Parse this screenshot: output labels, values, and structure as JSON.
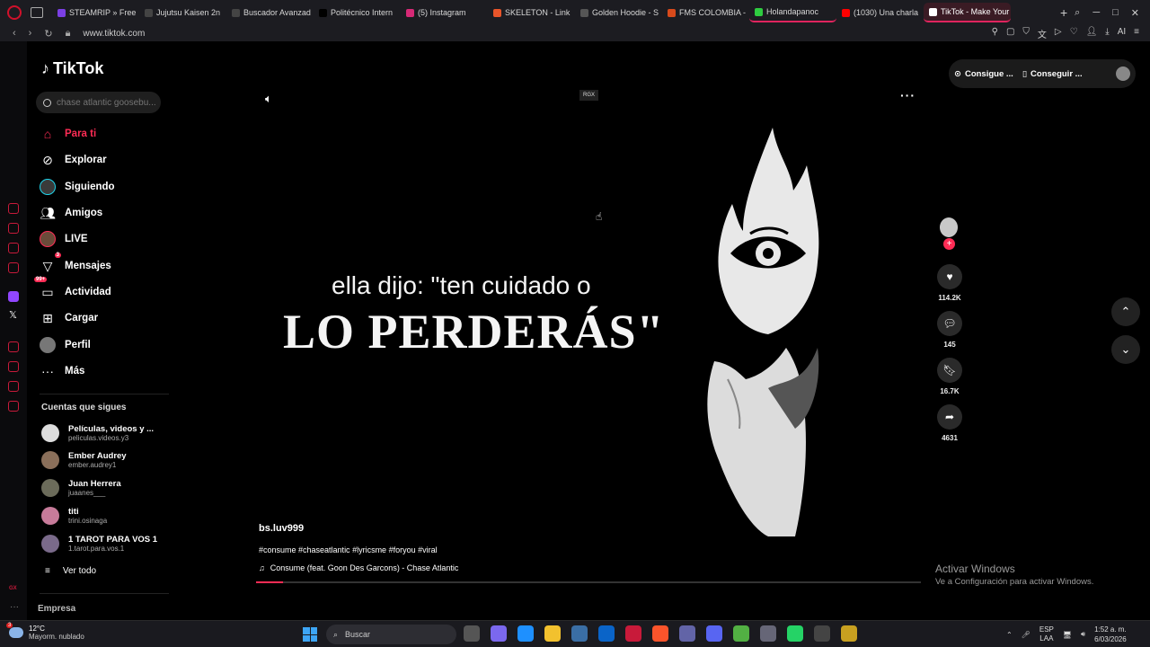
{
  "browser": {
    "tabs": [
      {
        "title": "STEAMRIP » Free",
        "color": "#7b3fe4"
      },
      {
        "title": "Jujutsu Kaisen 2n",
        "color": "#444444"
      },
      {
        "title": "Buscador Avanzad",
        "color": "#444444"
      },
      {
        "title": "Politécnico Intern",
        "color": "#000000"
      },
      {
        "title": "(5) Instagram",
        "color": "#d62976"
      },
      {
        "title": "SKELETON - Link",
        "color": "#e8552a"
      },
      {
        "title": "Golden Hoodie - S",
        "color": "#555555"
      },
      {
        "title": "FMS COLOMBIA -",
        "color": "#d84a1b"
      },
      {
        "title": "Holandapanoc",
        "color": "#2ecc40"
      },
      {
        "title": "(1030) Una charla",
        "color": "#ff0000"
      },
      {
        "title": "TikTok - Make Your Da",
        "color": "#ffffff"
      }
    ],
    "url": "www.tiktok.com"
  },
  "tiktok": {
    "logo": "TikTok",
    "search_placeholder": "chase atlantic goosebu...",
    "menu": [
      {
        "label": "Para ti",
        "icon": "home-icon"
      },
      {
        "label": "Explorar",
        "icon": "compass-icon"
      },
      {
        "label": "Siguiendo",
        "icon": "following-icon"
      },
      {
        "label": "Amigos",
        "icon": "friends-icon"
      },
      {
        "label": "LIVE",
        "icon": "live-icon"
      },
      {
        "label": "Mensajes",
        "icon": "messages-icon",
        "badge": "3"
      },
      {
        "label": "Actividad",
        "icon": "activity-icon",
        "badge": "99+"
      },
      {
        "label": "Cargar",
        "icon": "upload-icon"
      },
      {
        "label": "Perfil",
        "icon": "profile-icon"
      },
      {
        "label": "Más",
        "icon": "more-icon"
      }
    ],
    "following_title": "Cuentas que sigues",
    "following": [
      {
        "name": "Películas, videos y ...",
        "user": "peliculas.videos.y3"
      },
      {
        "name": "Ember Audrey",
        "user": "ember.audrey1"
      },
      {
        "name": "Juan Herrera",
        "user": "juaanes___"
      },
      {
        "name": "titi",
        "user": "trini.osinaga"
      },
      {
        "name": "1 TAROT PARA VOS 1",
        "user": "1.tarot.para.vos.1"
      }
    ],
    "see_all": "Ver todo",
    "footer": "Empresa",
    "pills": [
      "Consigue ...",
      "Conseguir ..."
    ]
  },
  "video": {
    "watermark": "RGX",
    "caption_line1": "ella dijo: \"ten cuidado o",
    "caption_line2": "LO PERDERÁS\"",
    "author": "bs.luv999",
    "hashtags": "#consume #chaseatlantic #lyricsme #foryou #viral",
    "song": "Consume (feat. Goon Des Garcons) - Chase Atlantic",
    "progress": 0.04,
    "likes": "114.2K",
    "comments": "145",
    "saves": "16.7K",
    "shares": "4631"
  },
  "windows": {
    "activate_title": "Activar Windows",
    "activate_sub": "Ve a Configuración para activar Windows.",
    "temp": "12°C",
    "weather": "Mayorm. nublado",
    "weather_badge": "3",
    "search": "Buscar",
    "lang1": "ESP",
    "lang2": "LAA",
    "time": "1:52 a. m.",
    "date": "6/03/2026"
  }
}
